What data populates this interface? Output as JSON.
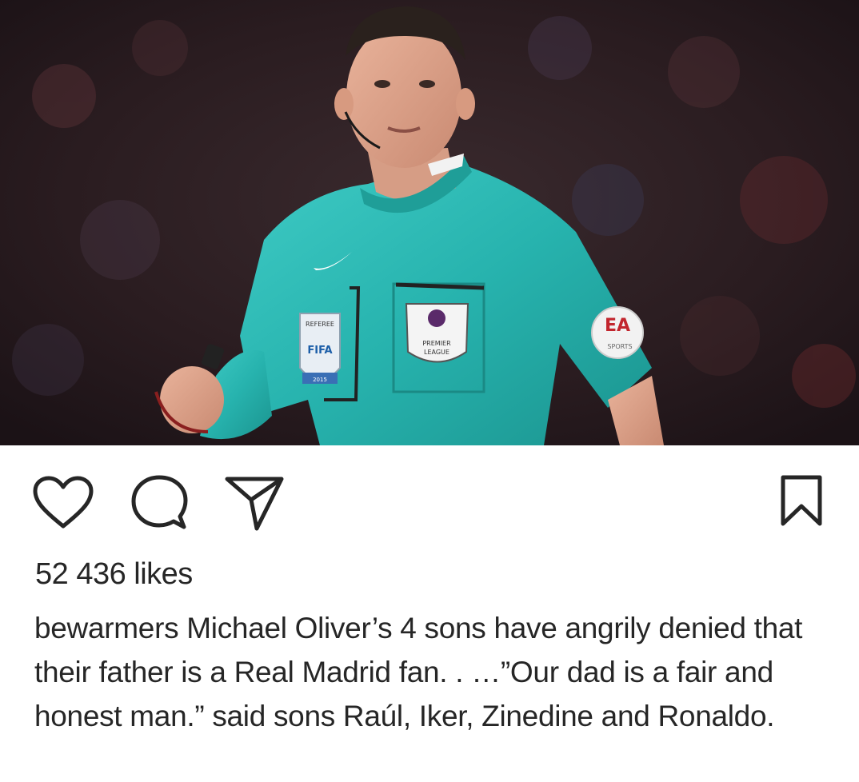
{
  "post": {
    "image": {
      "icon": "referee-photo",
      "badges": {
        "referee_badge_top": "REFEREE",
        "referee_badge_mid": "FIFA",
        "referee_badge_year": "2015",
        "league_badge_line1": "PREMIER",
        "league_badge_line2": "LEAGUE",
        "sleeve_patch": "SPORTS"
      }
    },
    "actions": {
      "like_icon": "heart-icon",
      "comment_icon": "speech-bubble-icon",
      "share_icon": "paper-plane-icon",
      "save_icon": "bookmark-icon"
    },
    "likes_text": "52 436 likes",
    "caption": {
      "username": "bewarmers",
      "text": "Michael Oliver’s 4 sons have angrily denied that their father is a Real Madrid fan. . …”Our dad is a fair and honest man.” said sons Raúl, Iker, Zinedine and Ronaldo."
    }
  }
}
